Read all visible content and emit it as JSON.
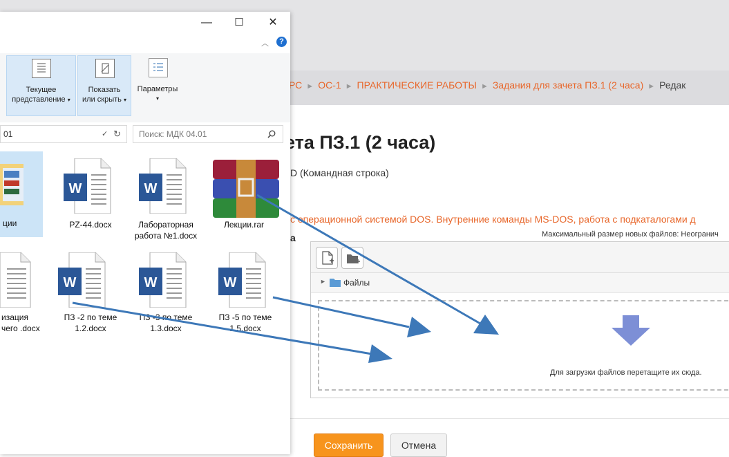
{
  "moodle": {
    "breadcrumb": [
      "РС",
      "ОС-1",
      "ПРАКТИЧЕСКИЕ РАБОТЫ",
      "Задания для зачета ПЗ.1 (2 часа)",
      "Редак"
    ],
    "title": "ета ПЗ.1 (2 часа)",
    "subtitle": "D (Командная строка)",
    "task_text": "с операционной системой DOS. Внутренние команды MS-DOS, работа с подкаталогами д",
    "field_label": "а",
    "max_size": "Максимальный размер новых файлов: Неогранич",
    "filepicker": {
      "folder_label": "Файлы",
      "drop_text": "Для загрузки файлов перетащите их сюда."
    },
    "save_label": "Сохранить",
    "cancel_label": "Отмена"
  },
  "explorer": {
    "window_buttons": {
      "minimize": "—",
      "maximize": "☐",
      "close": "✕"
    },
    "help": "?",
    "ribbon": {
      "view_label_1": "Текущее",
      "view_label_2": "представление",
      "show_label_1": "Показать",
      "show_label_2": "или скрыть",
      "params_label": "Параметры"
    },
    "address": "01",
    "search_placeholder": "Поиск: МДК 04.01",
    "files": [
      {
        "name": "ции",
        "type": "folder"
      },
      {
        "name": "PZ-44.docx",
        "type": "word"
      },
      {
        "name": "Лабораторная работа №1.docx",
        "type": "word"
      },
      {
        "name": "Лекции.rar",
        "type": "rar"
      },
      {
        "name": "изация чего .docx",
        "type": "word"
      },
      {
        "name": "ПЗ -2 по теме 1.2.docx",
        "type": "word"
      },
      {
        "name": "ПЗ -3 по теме 1.3.docx",
        "type": "word"
      },
      {
        "name": "ПЗ -5 по теме 1.5.docx",
        "type": "word"
      }
    ]
  },
  "colors": {
    "accent": "#f7941d",
    "link": "#e8672b",
    "word_blue": "#2b5797",
    "arrow": "#3d78b8"
  }
}
